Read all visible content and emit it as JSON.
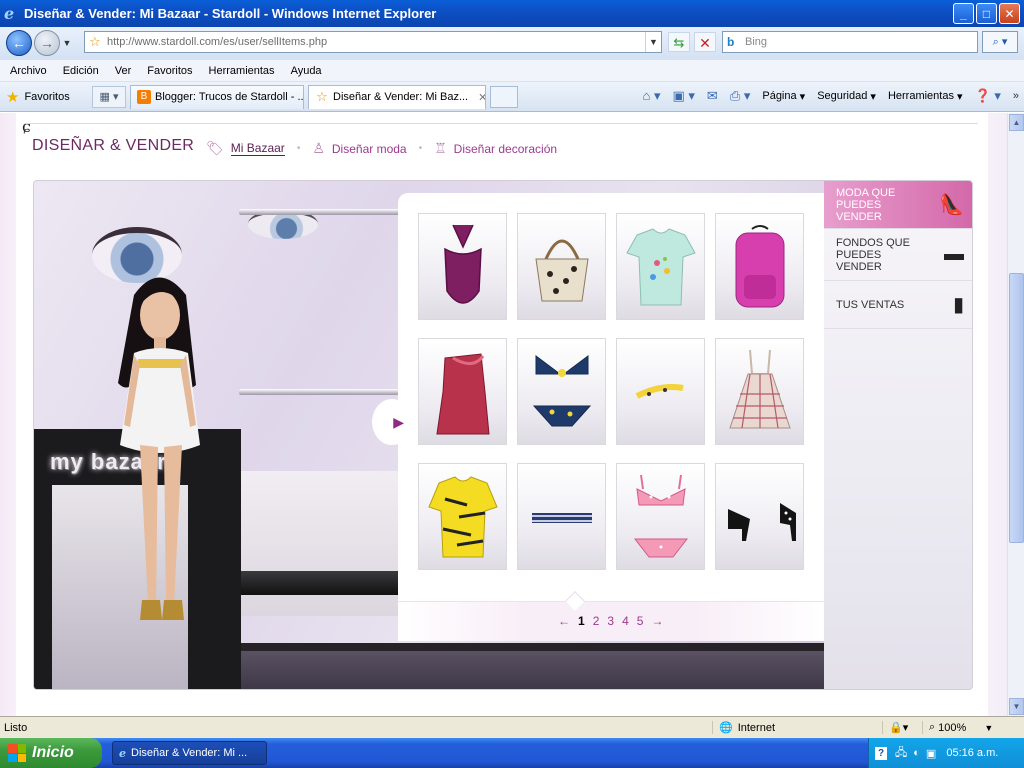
{
  "window": {
    "title": "Diseñar & Vender: Mi Bazaar - Stardoll - Windows Internet Explorer",
    "controls": {
      "minimize": "_",
      "maximize": "□",
      "close": "✕"
    }
  },
  "address_bar": {
    "url": "http://www.stardoll.com/es/user/sellItems.php",
    "search_placeholder": "Bing"
  },
  "menu": [
    "Archivo",
    "Edición",
    "Ver",
    "Favoritos",
    "Herramientas",
    "Ayuda"
  ],
  "favorites_label": "Favoritos",
  "tabs": [
    {
      "label": "Blogger: Trucos de Stardoll - ...",
      "active": false,
      "icon": "blogger-icon"
    },
    {
      "label": "Diseñar & Vender: Mi Baz...",
      "active": true,
      "icon": "star-icon"
    }
  ],
  "command_bar": [
    "Página",
    "Seguridad",
    "Herramientas"
  ],
  "page": {
    "heading": "DISEÑAR & VENDER",
    "subnav": [
      {
        "label": "Mi Bazaar",
        "active": true,
        "icon": "tag-icon"
      },
      {
        "label": "Diseñar moda",
        "active": false,
        "icon": "mannequin-icon"
      },
      {
        "label": "Diseñar decoración",
        "active": false,
        "icon": "chair-icon"
      }
    ],
    "room_sign": "my bazaar",
    "items": [
      {
        "name": "purple swimsuit",
        "icon": "swimsuit-icon"
      },
      {
        "name": "leopard handbag",
        "icon": "handbag-icon"
      },
      {
        "name": "mint printed t-shirt",
        "icon": "tshirt-icon"
      },
      {
        "name": "pink backpack",
        "icon": "backpack-icon"
      },
      {
        "name": "red ruffle top",
        "icon": "ruffle-top-icon"
      },
      {
        "name": "navy heart bikini",
        "icon": "bikini-icon"
      },
      {
        "name": "yellow hair band",
        "icon": "headband-icon"
      },
      {
        "name": "plaid dress",
        "icon": "dress-icon"
      },
      {
        "name": "tiger print top",
        "icon": "tiger-top-icon"
      },
      {
        "name": "striped belt",
        "icon": "belt-icon"
      },
      {
        "name": "pink polka bikini",
        "icon": "polka-bikini-icon"
      },
      {
        "name": "black heels",
        "icon": "heels-icon"
      }
    ],
    "pager": {
      "prev": "←",
      "pages": [
        "1",
        "2",
        "3",
        "4",
        "5"
      ],
      "current": "1",
      "next": "→"
    },
    "side_menu": [
      {
        "label": "MODA QUE PUEDES VENDER",
        "active": true,
        "icon": "shoe-icon"
      },
      {
        "label": "FONDOS QUE PUEDES VENDER",
        "active": false,
        "icon": "sofa-icon"
      },
      {
        "label": "TUS VENTAS",
        "active": false,
        "icon": "receipt-icon"
      }
    ]
  },
  "status": {
    "left": "Listo",
    "zone": "Internet",
    "zoom": "100%"
  },
  "taskbar": {
    "start": "Inicio",
    "task": "Diseñar & Vender: Mi ...",
    "clock": "05:16 a.m."
  },
  "colors": {
    "accent": "#9c3a8f",
    "heading": "#6b2a63",
    "side_active": "#d468a9"
  }
}
